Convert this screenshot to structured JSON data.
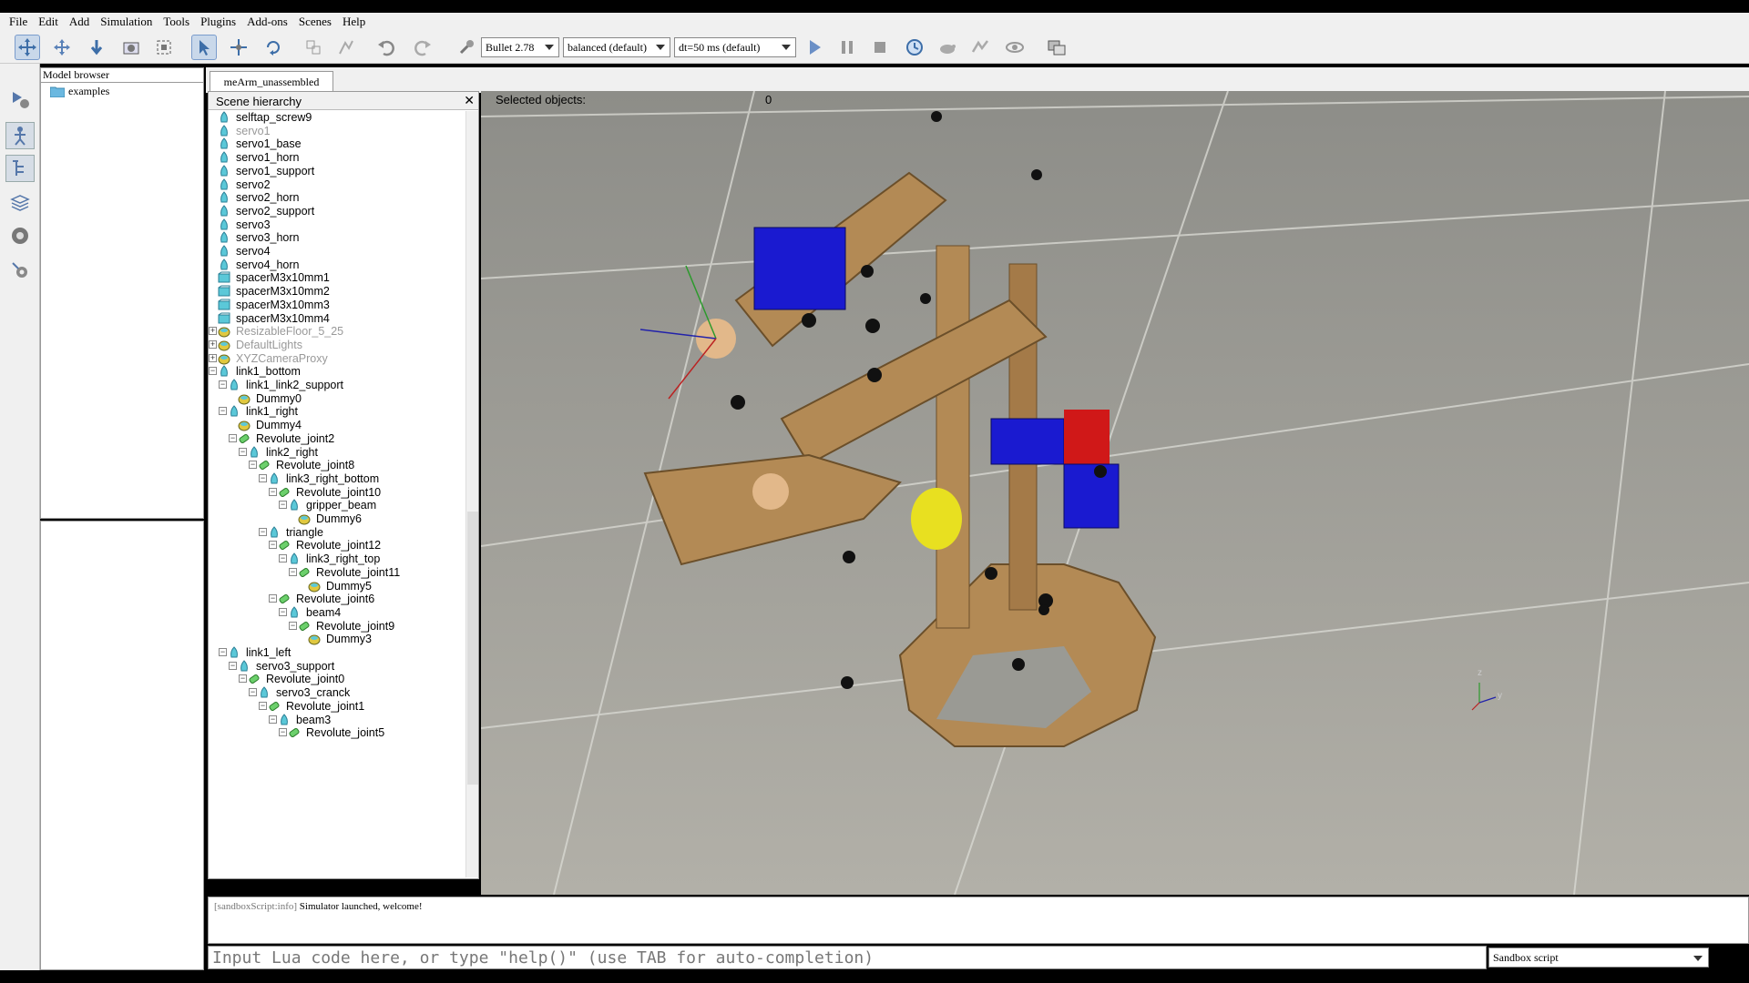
{
  "menu": [
    "File",
    "Edit",
    "Add",
    "Simulation",
    "Tools",
    "Plugins",
    "Add-ons",
    "Scenes",
    "Help"
  ],
  "toolbar": {
    "engine": "Bullet 2.78",
    "mode": "balanced (default)",
    "dt": "dt=50 ms (default)"
  },
  "model_browser": {
    "title": "Model browser",
    "folder": "examples"
  },
  "tab": {
    "label": "meArm_unassembled"
  },
  "scene_hierarchy": {
    "title": "Scene hierarchy",
    "items": [
      {
        "label": "selftap_screw9",
        "icon": "shape",
        "dim": false
      },
      {
        "label": "servo1",
        "icon": "shape",
        "dim": true
      },
      {
        "label": "servo1_base",
        "icon": "shape",
        "dim": false
      },
      {
        "label": "servo1_horn",
        "icon": "shape",
        "dim": false
      },
      {
        "label": "servo1_support",
        "icon": "shape",
        "dim": false
      },
      {
        "label": "servo2",
        "icon": "shape",
        "dim": false
      },
      {
        "label": "servo2_horn",
        "icon": "shape",
        "dim": false
      },
      {
        "label": "servo2_support",
        "icon": "shape",
        "dim": false
      },
      {
        "label": "servo3",
        "icon": "shape",
        "dim": false
      },
      {
        "label": "servo3_horn",
        "icon": "shape",
        "dim": false
      },
      {
        "label": "servo4",
        "icon": "shape",
        "dim": false
      },
      {
        "label": "servo4_horn",
        "icon": "shape",
        "dim": false
      },
      {
        "label": "spacerM3x10mm1",
        "icon": "compound",
        "dim": false
      },
      {
        "label": "spacerM3x10mm2",
        "icon": "compound",
        "dim": false
      },
      {
        "label": "spacerM3x10mm3",
        "icon": "compound",
        "dim": false
      },
      {
        "label": "spacerM3x10mm4",
        "icon": "compound",
        "dim": false
      },
      {
        "label": "ResizableFloor_5_25",
        "icon": "dummy",
        "dim": true
      },
      {
        "label": "DefaultLights",
        "icon": "dummy",
        "dim": true
      },
      {
        "label": "XYZCameraProxy",
        "icon": "dummy",
        "dim": true
      },
      {
        "label": "link1_bottom",
        "icon": "shape",
        "dim": false
      },
      {
        "label": "link1_link2_support",
        "icon": "shape",
        "dim": false
      },
      {
        "label": "Dummy0",
        "icon": "dummy",
        "dim": false
      },
      {
        "label": "link1_right",
        "icon": "shape",
        "dim": false
      },
      {
        "label": "Dummy4",
        "icon": "dummy",
        "dim": false
      },
      {
        "label": "Revolute_joint2",
        "icon": "joint",
        "dim": false
      },
      {
        "label": "link2_right",
        "icon": "shape",
        "dim": false
      },
      {
        "label": "Revolute_joint8",
        "icon": "joint",
        "dim": false
      },
      {
        "label": "link3_right_bottom",
        "icon": "shape",
        "dim": false
      },
      {
        "label": "Revolute_joint10",
        "icon": "joint",
        "dim": false
      },
      {
        "label": "gripper_beam",
        "icon": "shape",
        "dim": false
      },
      {
        "label": "Dummy6",
        "icon": "dummy",
        "dim": false
      },
      {
        "label": "triangle",
        "icon": "shape",
        "dim": false
      },
      {
        "label": "Revolute_joint12",
        "icon": "joint",
        "dim": false
      },
      {
        "label": "link3_right_top",
        "icon": "shape",
        "dim": false
      },
      {
        "label": "Revolute_joint11",
        "icon": "joint",
        "dim": false
      },
      {
        "label": "Dummy5",
        "icon": "dummy",
        "dim": false
      },
      {
        "label": "Revolute_joint6",
        "icon": "joint",
        "dim": false
      },
      {
        "label": "beam4",
        "icon": "shape",
        "dim": false
      },
      {
        "label": "Revolute_joint9",
        "icon": "joint",
        "dim": false
      },
      {
        "label": "Dummy3",
        "icon": "dummy",
        "dim": false
      },
      {
        "label": "link1_left",
        "icon": "shape",
        "dim": false
      },
      {
        "label": "servo3_support",
        "icon": "shape",
        "dim": false
      },
      {
        "label": "Revolute_joint0",
        "icon": "joint",
        "dim": false
      },
      {
        "label": "servo3_cranck",
        "icon": "shape",
        "dim": false
      },
      {
        "label": "Revolute_joint1",
        "icon": "joint",
        "dim": false
      },
      {
        "label": "beam3",
        "icon": "shape",
        "dim": false
      },
      {
        "label": "Revolute_joint5",
        "icon": "joint",
        "dim": false
      }
    ]
  },
  "viewport": {
    "selected_label": "Selected objects:",
    "selected_count": "0",
    "axis_z": "z",
    "axis_y": "y"
  },
  "console": {
    "prefix": "[sandboxScript:info]",
    "message": "Simulator launched, welcome!"
  },
  "lua_input": {
    "placeholder": "Input Lua code here, or type \"help()\" (use TAB for auto-completion)"
  },
  "script_select": {
    "value": "Sandbox script"
  }
}
